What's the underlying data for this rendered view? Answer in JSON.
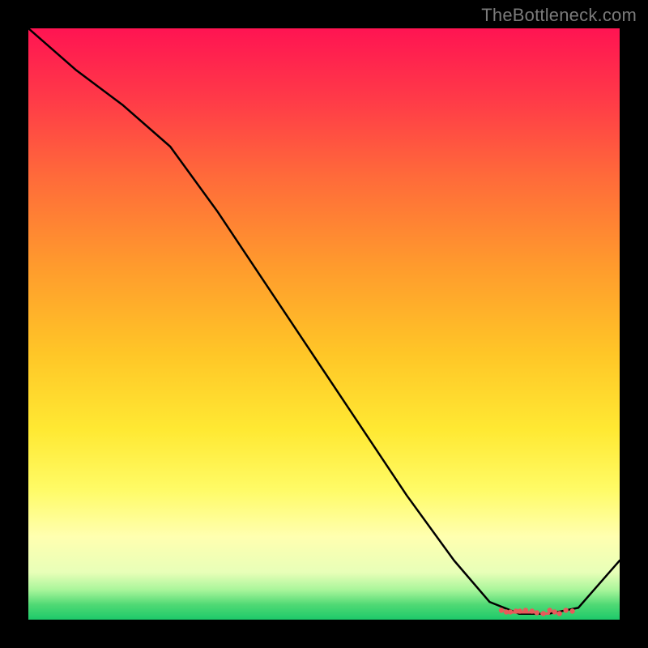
{
  "watermark": "TheBottleneck.com",
  "chart_data": {
    "type": "line",
    "title": "",
    "xlabel": "",
    "ylabel": "",
    "xlim": [
      0,
      100
    ],
    "ylim": [
      0,
      100
    ],
    "series": [
      {
        "name": "curve",
        "x": [
          0,
          8,
          16,
          24,
          32,
          40,
          48,
          56,
          64,
          72,
          78,
          83,
          88,
          93,
          100
        ],
        "y": [
          100,
          93,
          87,
          80,
          69,
          57,
          45,
          33,
          21,
          10,
          3,
          1,
          1,
          2,
          10
        ]
      }
    ],
    "optimum_band": {
      "x_from": 80,
      "x_to": 92,
      "color": "#e85a5a"
    }
  }
}
